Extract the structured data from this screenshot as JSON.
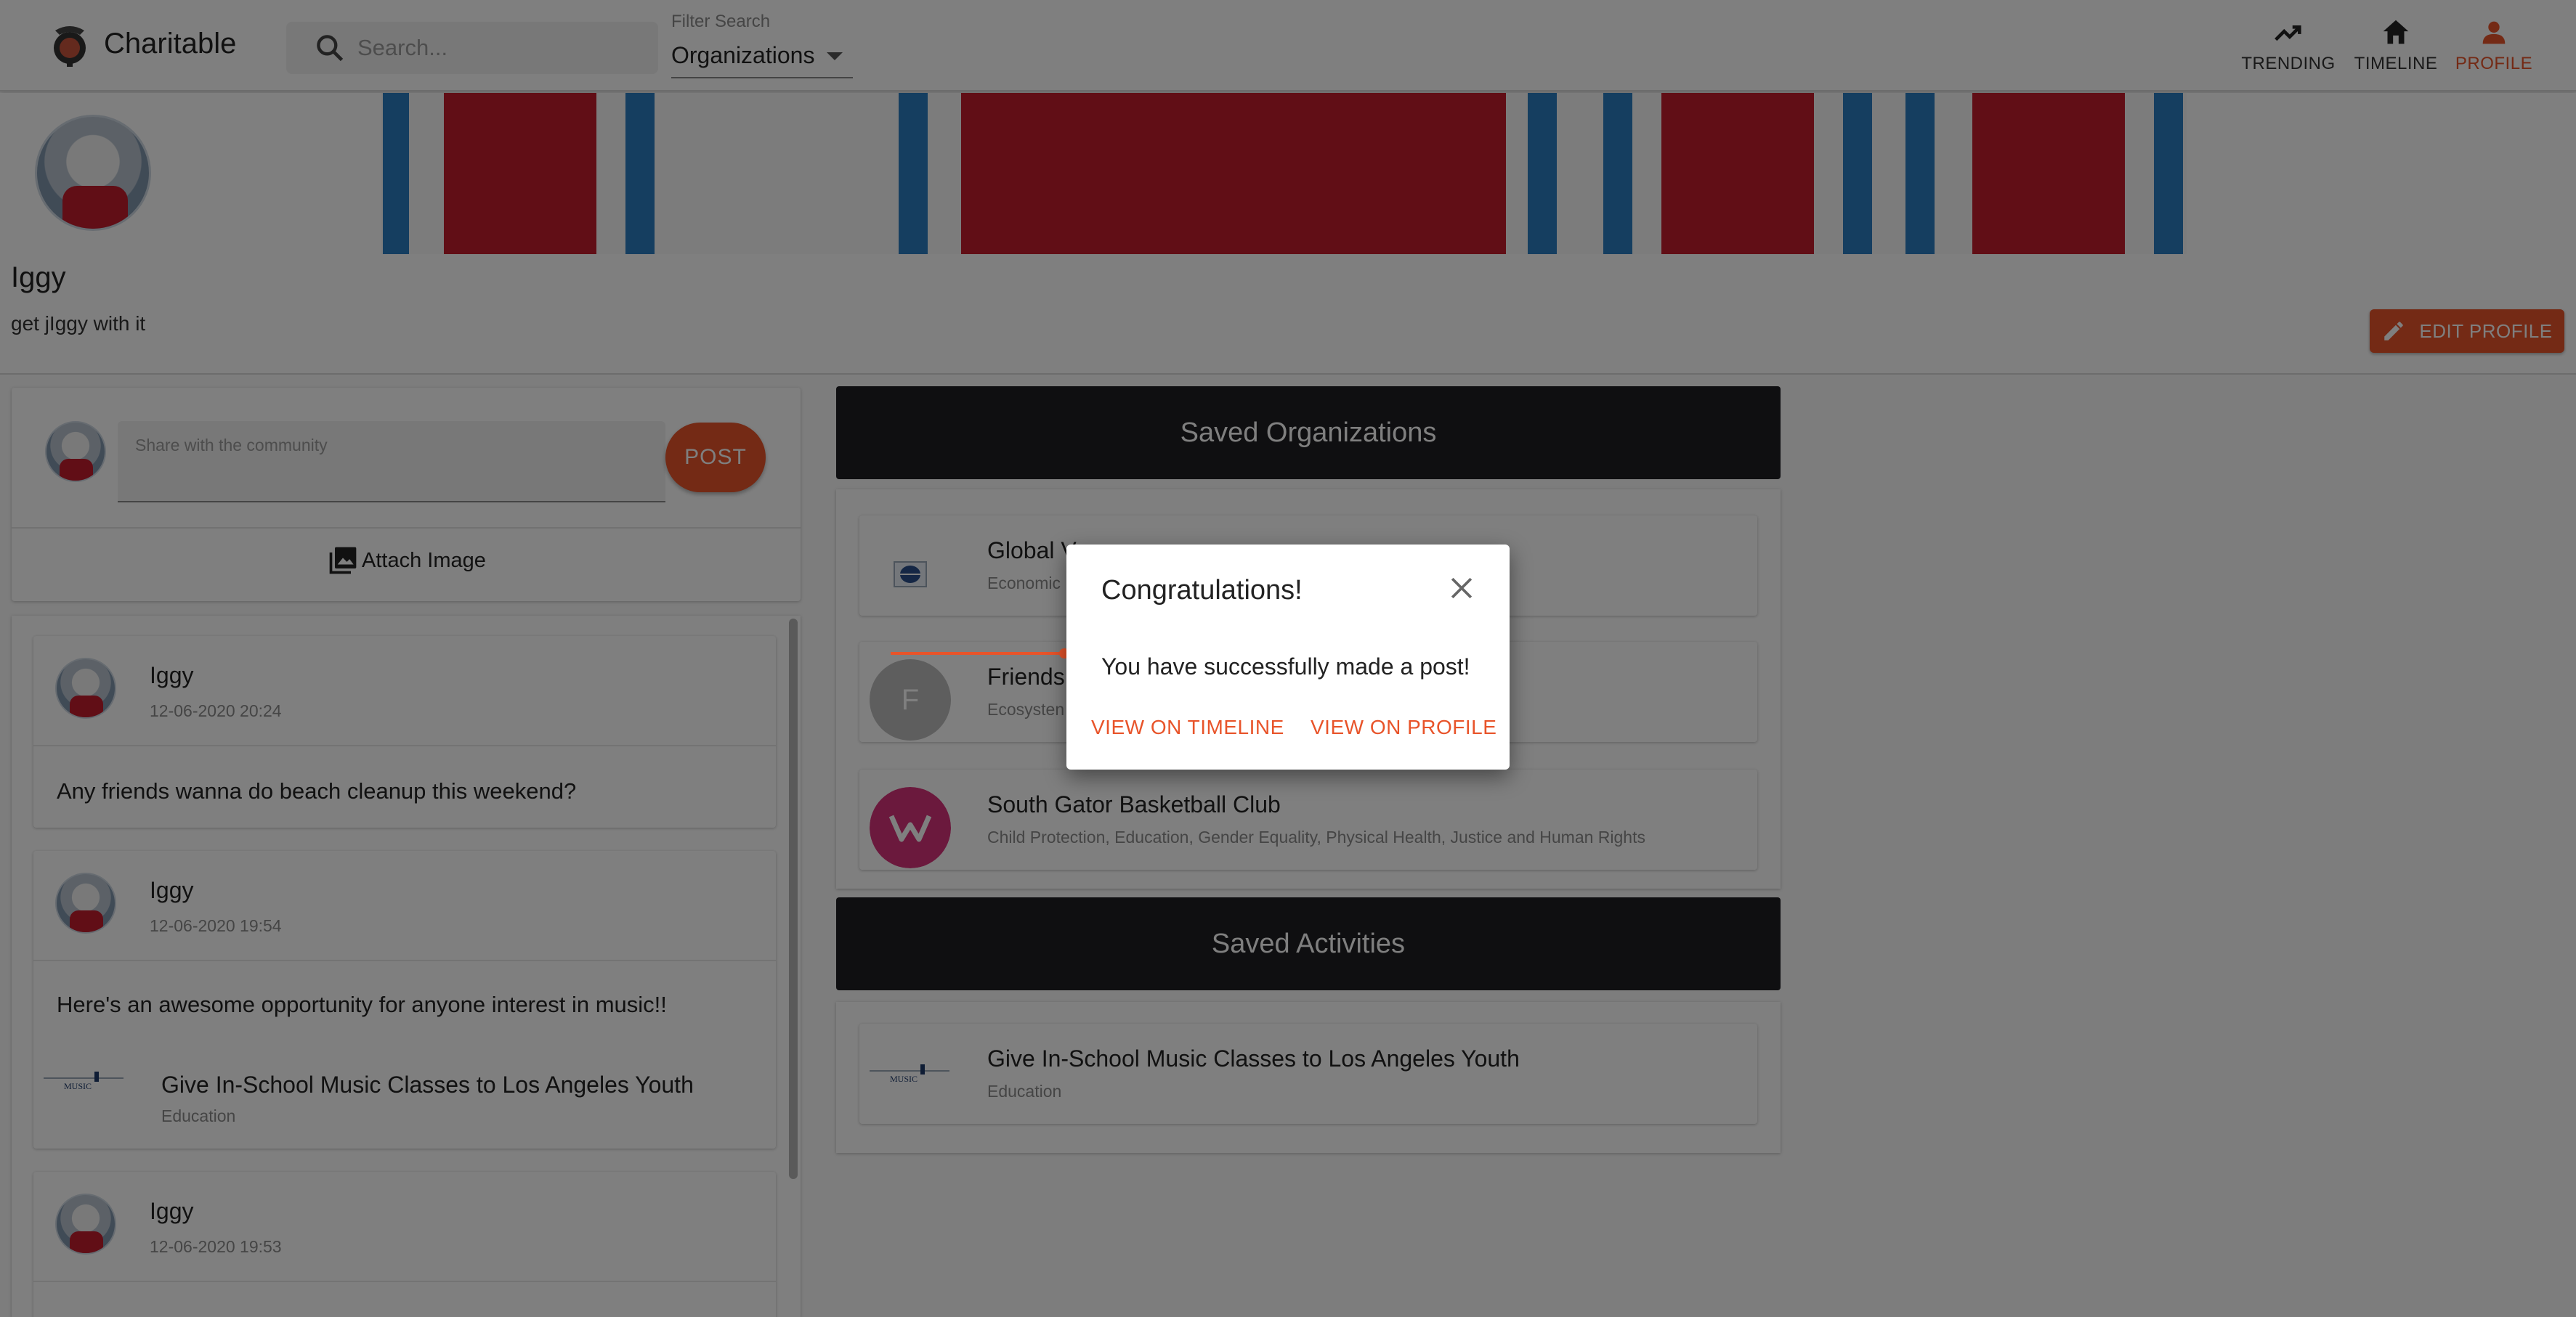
{
  "app": {
    "brand": "Charitable"
  },
  "search": {
    "placeholder": "Search..."
  },
  "filter": {
    "label": "Filter Search",
    "value": "Organizations"
  },
  "nav": [
    {
      "label": "TRENDING",
      "icon": "trending-icon"
    },
    {
      "label": "TIMELINE",
      "icon": "home-icon"
    },
    {
      "label": "PROFILE",
      "icon": "person-icon",
      "active": true
    }
  ],
  "profile": {
    "name": "Iggy",
    "bio": "get jIggy with it",
    "edit_label": "EDIT PROFILE"
  },
  "composer": {
    "placeholder": "Share with the community",
    "post_label": "POST",
    "attach_label": "Attach Image"
  },
  "feed": {
    "posts": [
      {
        "author": "Iggy",
        "time": "12-06-2020 20:24",
        "text": "Any friends wanna do beach cleanup this weekend?"
      },
      {
        "author": "Iggy",
        "time": "12-06-2020 19:54",
        "text": "Here's an awesome opportunity for anyone interest in music!!",
        "activity": {
          "title": "Give In-School Music Classes to Los Angeles Youth",
          "category": "Education"
        }
      },
      {
        "author": "Iggy",
        "time": "12-06-2020 19:53"
      }
    ]
  },
  "saved_orgs": {
    "title": "Saved Organizations",
    "items": [
      {
        "title": "Global V",
        "sub": "Economic"
      },
      {
        "title": "Friends",
        "sub": "Ecosysten",
        "initial": "F"
      },
      {
        "title": "South Gator Basketball Club",
        "sub": "Child Protection, Education, Gender Equality, Physical Health, Justice and Human Rights"
      }
    ]
  },
  "saved_activities": {
    "title": "Saved Activities",
    "items": [
      {
        "title": "Give In-School Music Classes to Los Angeles Youth",
        "sub": "Education"
      }
    ]
  },
  "dialog": {
    "title": "Congratulations!",
    "message": "You have successfully made a post!",
    "timeline_label": "VIEW ON TIMELINE",
    "profile_label": "VIEW ON PROFILE"
  },
  "colors": {
    "accent": "#e8542a",
    "header_dark": "#1e1f22",
    "cover_red": "#c21d2d",
    "cover_blue": "#2b7cc1"
  }
}
